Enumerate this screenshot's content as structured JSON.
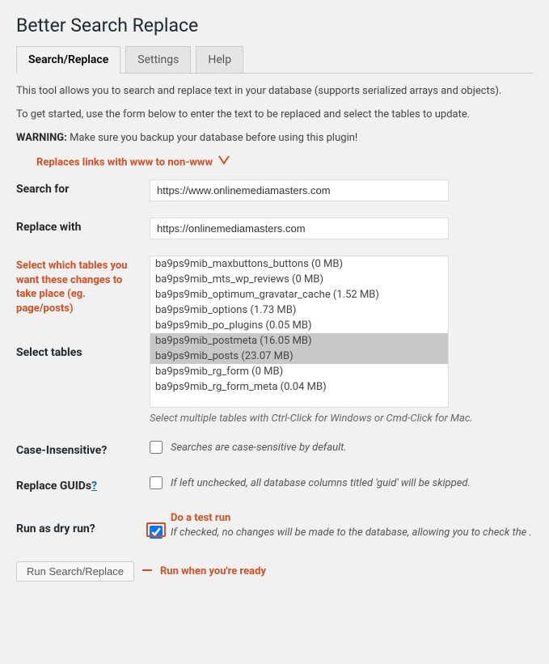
{
  "page_title": "Better Search Replace",
  "tabs": [
    {
      "label": "Search/Replace",
      "active": true
    },
    {
      "label": "Settings",
      "active": false
    },
    {
      "label": "Help",
      "active": false
    }
  ],
  "intro": {
    "line1": "This tool allows you to search and replace text in your database (supports serialized arrays and objects).",
    "line2": "To get started, use the form below to enter the text to be replaced and select the tables to update.",
    "warning_label": "WARNING:",
    "warning_text": " Make sure you backup your database before using this plugin!"
  },
  "annotations": {
    "top": "Replaces links with www to non-www",
    "tables": "Select which tables you want these changes to take place (eg. page/posts)",
    "dryrun": "Do a test run",
    "submit": "Run when you're ready"
  },
  "fields": {
    "search": {
      "label": "Search for",
      "value": "https://www.onlinemediamasters.com"
    },
    "replace": {
      "label": "Replace with",
      "value": "https://onlinemediamasters.com"
    },
    "tables": {
      "label": "Select tables",
      "hint": "Select multiple tables with Ctrl-Click for Windows or Cmd-Click for Mac.",
      "options": [
        {
          "text": "ba9ps9mib_maxbuttons_buttons (0 MB)",
          "selected": false
        },
        {
          "text": "ba9ps9mib_mts_wp_reviews (0 MB)",
          "selected": false
        },
        {
          "text": "ba9ps9mib_optimum_gravatar_cache (1.52 MB)",
          "selected": false
        },
        {
          "text": "ba9ps9mib_options (1.73 MB)",
          "selected": false
        },
        {
          "text": "ba9ps9mib_po_plugins (0.05 MB)",
          "selected": false
        },
        {
          "text": "ba9ps9mib_postmeta (16.05 MB)",
          "selected": true
        },
        {
          "text": "ba9ps9mib_posts (23.07 MB)",
          "selected": true
        },
        {
          "text": "ba9ps9mib_rg_form (0 MB)",
          "selected": false
        },
        {
          "text": "ba9ps9mib_rg_form_meta (0.04 MB)",
          "selected": false
        }
      ]
    },
    "case": {
      "label": "Case-Insensitive?",
      "desc": "Searches are case-sensitive by default."
    },
    "guids": {
      "label": "Replace GUIDs",
      "help": "?",
      "desc": "If left unchecked, all database columns titled 'guid' will be skipped."
    },
    "dryrun": {
      "label": "Run as dry run?",
      "desc": "If checked, no changes will be made to the database, allowing you to check the ."
    }
  },
  "submit_label": "Run Search/Replace"
}
